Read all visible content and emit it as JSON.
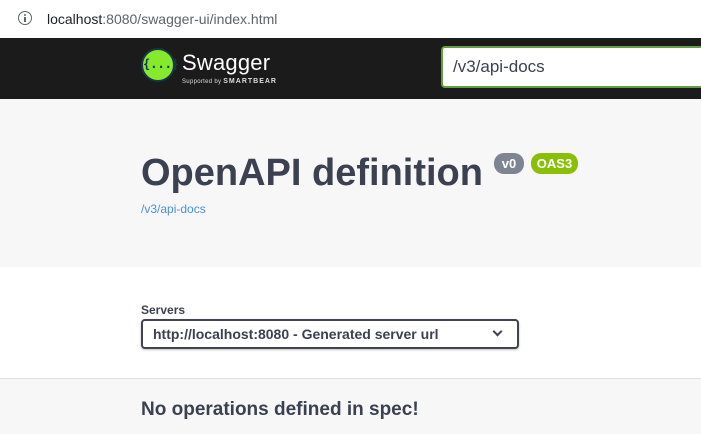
{
  "browser": {
    "url_host": "localhost",
    "url_rest": ":8080/swagger-ui/index.html",
    "info_icon": "info-icon"
  },
  "topbar": {
    "logo_symbol": "{...}",
    "logo_name": "Swagger",
    "logo_supported_by": "Supported by",
    "logo_company": "SMARTBEAR",
    "search_value": "/v3/api-docs"
  },
  "info": {
    "title": "OpenAPI definition",
    "version_badge": "v0",
    "oas_badge": "OAS3",
    "docs_link": "/v3/api-docs"
  },
  "servers": {
    "label": "Servers",
    "selected": "http://localhost:8080 - Generated server url"
  },
  "operations": {
    "empty_message": "No operations defined in spec!"
  },
  "colors": {
    "topbar": "#1b1b1b",
    "accent_green": "#85ea2d",
    "input_border": "#62a03f",
    "oas_badge": "#89bf04",
    "version_badge": "#7d8492",
    "text": "#3b4151",
    "link": "#4990e2"
  }
}
